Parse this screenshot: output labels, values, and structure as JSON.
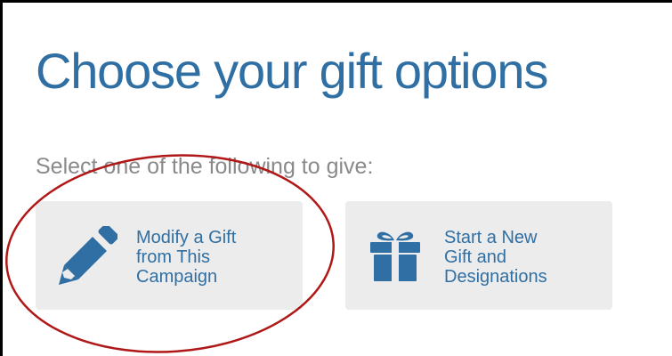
{
  "page": {
    "title": "Choose your gift options",
    "subtitle": "Select one of the following to give:"
  },
  "options": [
    {
      "label": "Modify a Gift\nfrom This\nCampaign",
      "icon": "pencil-icon"
    },
    {
      "label": "Start a New\nGift and\nDesignations",
      "icon": "gift-icon"
    }
  ],
  "colors": {
    "title": "#2f6fa3",
    "subtitle": "#8a8a8a",
    "option_bg": "#ececec",
    "icon": "#2f6fa3",
    "annotation": "#b01818"
  }
}
